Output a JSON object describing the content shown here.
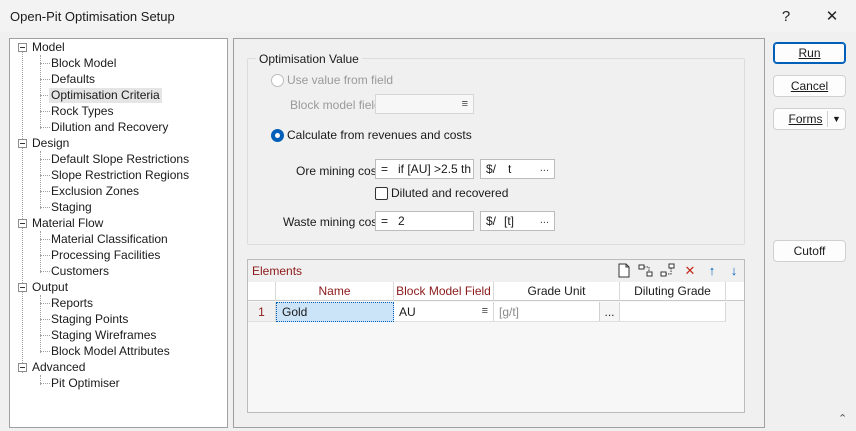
{
  "window": {
    "title": "Open-Pit Optimisation Setup",
    "help_label": "?",
    "close_label": "✕"
  },
  "tree": {
    "groups": [
      {
        "label": "Model",
        "children": [
          "Block Model",
          "Defaults",
          "Optimisation Criteria",
          "Rock Types",
          "Dilution and Recovery"
        ]
      },
      {
        "label": "Design",
        "children": [
          "Default Slope Restrictions",
          "Slope Restriction Regions",
          "Exclusion Zones",
          "Staging"
        ]
      },
      {
        "label": "Material Flow",
        "children": [
          "Material Classification",
          "Processing Facilities",
          "Customers"
        ]
      },
      {
        "label": "Output",
        "children": [
          "Reports",
          "Staging Points",
          "Staging Wireframes",
          "Block Model Attributes"
        ]
      },
      {
        "label": "Advanced",
        "children": [
          "Pit Optimiser"
        ]
      }
    ],
    "selected": "Optimisation Criteria"
  },
  "optimisation_value": {
    "group_title": "Optimisation Value",
    "use_value_from_field_label": "Use value from field",
    "block_model_field_label": "Block model field",
    "block_model_field_value": "",
    "calculate_label": "Calculate from revenues and costs",
    "ore_mining_cost_label": "Ore mining cost",
    "ore_mining_cost_eq": "=",
    "ore_mining_cost_value": "if [AU] >2.5 th",
    "ore_unit_prefix": "$/",
    "ore_unit_value": "t",
    "ore_unit_button": "...",
    "diluted_label": "Diluted and recovered",
    "waste_mining_cost_label": "Waste mining cost",
    "waste_mining_cost_eq": "=",
    "waste_mining_cost_value": "2",
    "waste_unit_prefix": "$/",
    "waste_unit_value": "[t]",
    "waste_unit_button": "..."
  },
  "elements": {
    "title": "Elements",
    "columns": [
      "Name",
      "Block Model Field",
      "Grade Unit",
      "Diluting Grade"
    ],
    "rows": [
      {
        "index": "1",
        "name": "Gold",
        "field": "AU",
        "grade_unit": "[g/t]",
        "grade_unit_button": "...",
        "diluting_grade": ""
      }
    ]
  },
  "buttons": {
    "run": "Run",
    "cancel": "Cancel",
    "forms": "Forms",
    "cutoff": "Cutoff"
  },
  "colors": {
    "accent": "#005fb8",
    "required_header": "#8b1a1a",
    "selected_cell": "#cce4f7"
  }
}
